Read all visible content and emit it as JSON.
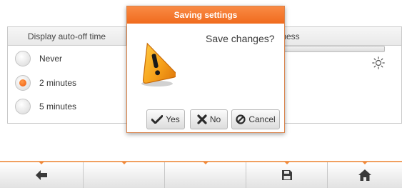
{
  "background": {
    "display_autooff_header": "Display auto-off time",
    "brightness_header": "tness",
    "options": [
      {
        "label": "Never",
        "selected": false
      },
      {
        "label": "2 minutes",
        "selected": true
      },
      {
        "label": "5 minutes",
        "selected": false
      }
    ],
    "brightness_level": 0,
    "brightness_icon": "sun-icon"
  },
  "dialog": {
    "title": "Saving settings",
    "message": "Save changes?",
    "icon": "warning-icon",
    "buttons": {
      "yes": "Yes",
      "no": "No",
      "cancel": "Cancel"
    }
  },
  "bottombar": {
    "buttons": [
      {
        "icon": "back-arrow-icon"
      },
      {
        "icon": ""
      },
      {
        "icon": ""
      },
      {
        "icon": "save-icon"
      },
      {
        "icon": "home-icon"
      }
    ]
  },
  "colors": {
    "accent": "#f06b1e",
    "dialog_title_bg": "#f98a44"
  }
}
